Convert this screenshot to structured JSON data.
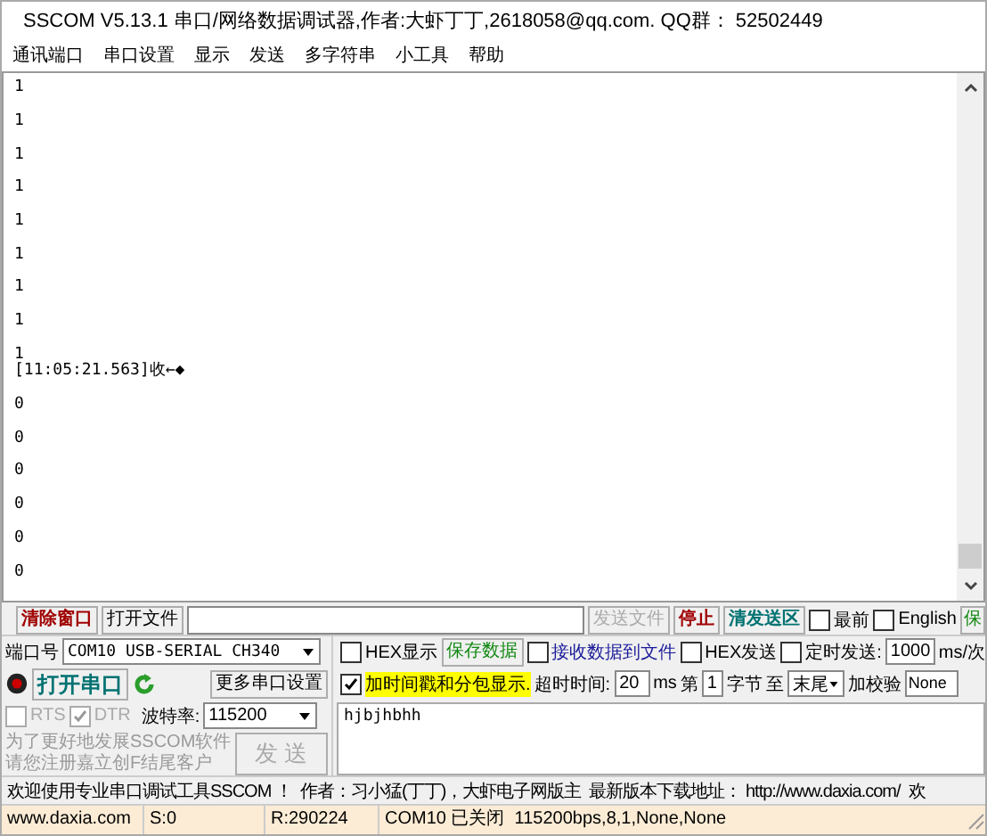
{
  "window": {
    "title": "SSCOM V5.13.1 串口/网络数据调试器,作者:大虾丁丁,2618058@qq.com. QQ群：  52502449"
  },
  "menu": [
    "通讯端口",
    "串口设置",
    "显示",
    "发送",
    "多字符串",
    "小工具",
    "帮助"
  ],
  "terminal": {
    "lines": [
      {
        "kind": "data",
        "text": "1"
      },
      {
        "kind": "data",
        "text": "1"
      },
      {
        "kind": "data",
        "text": "1"
      },
      {
        "kind": "data",
        "text": "1"
      },
      {
        "kind": "data",
        "text": "1"
      },
      {
        "kind": "data",
        "text": "1"
      },
      {
        "kind": "data",
        "text": "1"
      },
      {
        "kind": "data",
        "text": "1"
      },
      {
        "kind": "data",
        "text": "1"
      },
      {
        "kind": "stamp",
        "text": "[11:05:21.563]收←◆"
      },
      {
        "kind": "data",
        "text": "0"
      },
      {
        "kind": "data",
        "text": "0"
      },
      {
        "kind": "data",
        "text": "0"
      },
      {
        "kind": "data",
        "text": "0"
      },
      {
        "kind": "data",
        "text": "0"
      },
      {
        "kind": "data",
        "text": "0"
      }
    ]
  },
  "toolbar": {
    "clear_button": "清除窗口",
    "open_file_button": "打开文件",
    "send_file_button": {
      "label": "发送文件",
      "disabled": true
    },
    "stop_button": "停止",
    "clear_send_button": "清发送区",
    "checks": [
      {
        "label": "最前",
        "checked": false
      },
      {
        "label": "English",
        "checked": false
      }
    ],
    "partial_button": "保"
  },
  "port": {
    "label": "端口号",
    "value": "COM10 USB-SERIAL CH340",
    "open_button": "打开串口",
    "more_button": "更多串口设置",
    "lines": [
      {
        "label": "RTS",
        "checked": false,
        "disabled": true
      },
      {
        "label": "DTR",
        "checked": true,
        "disabled": true
      }
    ],
    "baud_label": "波特率:",
    "baud_value": "115200",
    "promo": [
      "为了更好地发展SSCOM软件",
      "请您注册嘉立创F结尾客户"
    ],
    "send_button": {
      "label": "发 送",
      "disabled": true
    }
  },
  "options": {
    "hex_display": {
      "label": "HEX显示",
      "checked": false
    },
    "save_button": "保存数据",
    "receive_to_file": {
      "label": "接收数据到文件",
      "checked": false
    },
    "hex_send": {
      "label": "HEX发送",
      "checked": false
    },
    "timed_send": {
      "label": "定时发送:",
      "checked": false
    },
    "interval": "1000",
    "interval_unit": "ms/次",
    "timestamp": {
      "label": "加时间戳和分包显示.",
      "checked": true
    },
    "timeout_label": "超时时间:",
    "timeout": "20",
    "timeout_unit": "ms",
    "from_label": "第",
    "from": "1",
    "byte_label": "字节",
    "to_label": "至",
    "to_value": "末尾",
    "checksum_label": "加校验",
    "checksum": "None"
  },
  "send_text": "hjbjhbhh",
  "marquee": "欢迎使用专业串口调试工具SSCOM ！  作者：习小猛(丁丁)，大虾电子网版主  最新版本下载地址： http://www.daxia.com/  欢",
  "status_bar": [
    "www.daxia.com",
    "S:0",
    "R:290224",
    "COM10 已关闭  115200bps,8,1,None,None"
  ]
}
